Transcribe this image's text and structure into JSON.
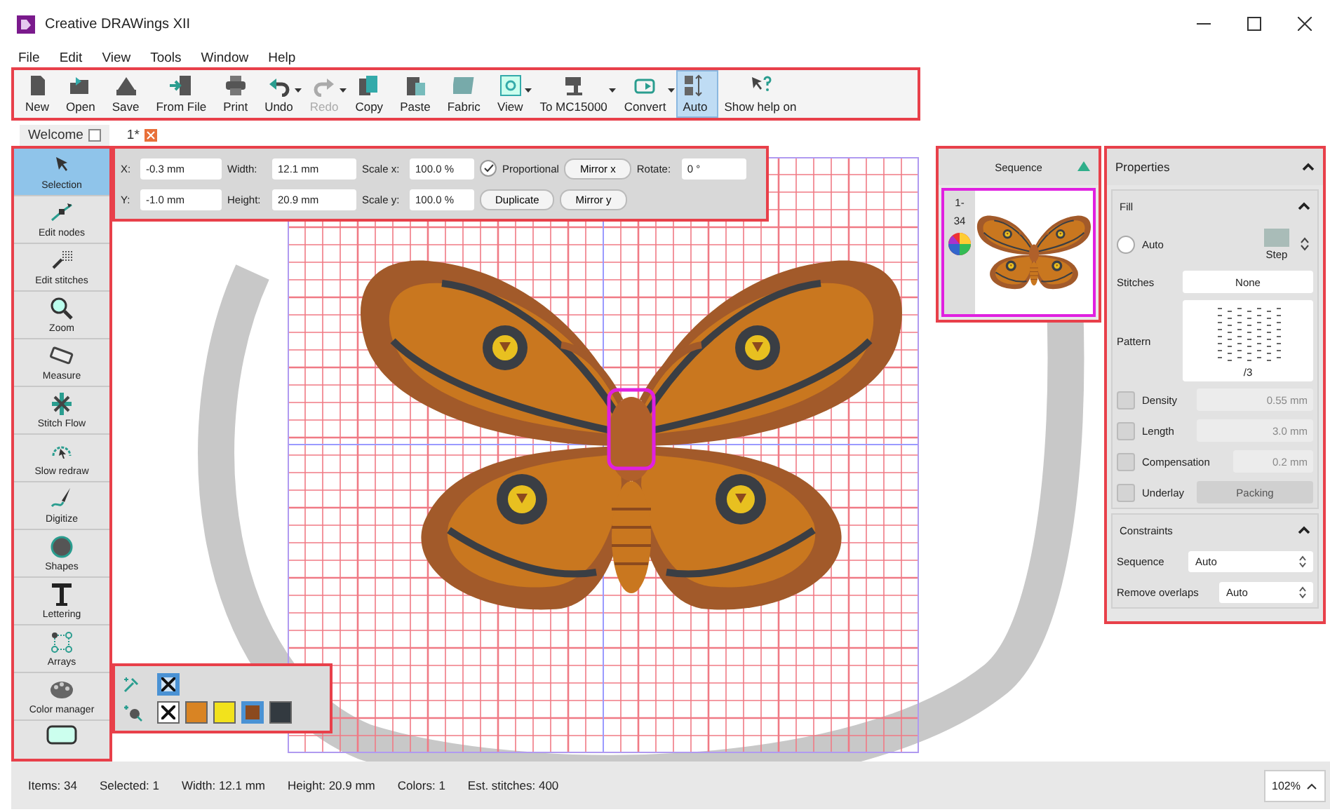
{
  "window": {
    "title": "Creative DRAWings XII"
  },
  "menu": [
    "File",
    "Edit",
    "View",
    "Tools",
    "Window",
    "Help"
  ],
  "toolbar": [
    {
      "label": "New",
      "dropdown": false,
      "disabled": false,
      "selected": false
    },
    {
      "label": "Open",
      "dropdown": false,
      "disabled": false,
      "selected": false
    },
    {
      "label": "Save",
      "dropdown": false,
      "disabled": false,
      "selected": false
    },
    {
      "label": "From File",
      "dropdown": false,
      "disabled": false,
      "selected": false
    },
    {
      "label": "Print",
      "dropdown": false,
      "disabled": false,
      "selected": false
    },
    {
      "label": "Undo",
      "dropdown": true,
      "disabled": false,
      "selected": false
    },
    {
      "label": "Redo",
      "dropdown": true,
      "disabled": true,
      "selected": false
    },
    {
      "label": "Copy",
      "dropdown": false,
      "disabled": false,
      "selected": false
    },
    {
      "label": "Paste",
      "dropdown": false,
      "disabled": false,
      "selected": false
    },
    {
      "label": "Fabric",
      "dropdown": false,
      "disabled": false,
      "selected": false
    },
    {
      "label": "View",
      "dropdown": true,
      "disabled": false,
      "selected": false
    },
    {
      "label": "To MC15000",
      "dropdown": true,
      "disabled": false,
      "selected": false
    },
    {
      "label": "Convert",
      "dropdown": true,
      "disabled": false,
      "selected": false
    },
    {
      "label": "Auto",
      "dropdown": false,
      "disabled": false,
      "selected": true
    },
    {
      "label": "Show help on",
      "dropdown": false,
      "disabled": false,
      "selected": false
    }
  ],
  "document_tabs": [
    {
      "label": "Welcome",
      "selected": false
    },
    {
      "label": "1*",
      "selected": true
    }
  ],
  "tools": [
    {
      "label": "Selection",
      "selected": true
    },
    {
      "label": "Edit nodes",
      "selected": false
    },
    {
      "label": "Edit stitches",
      "selected": false
    },
    {
      "label": "Zoom",
      "selected": false
    },
    {
      "label": "Measure",
      "selected": false
    },
    {
      "label": "Stitch Flow",
      "selected": false
    },
    {
      "label": "Slow redraw",
      "selected": false
    },
    {
      "label": "Digitize",
      "selected": false
    },
    {
      "label": "Shapes",
      "selected": false
    },
    {
      "label": "Lettering",
      "selected": false
    },
    {
      "label": "Arrays",
      "selected": false
    },
    {
      "label": "Color manager",
      "selected": false
    }
  ],
  "transform_bar": {
    "rows": [
      [
        {
          "kind": "field",
          "label": "X:",
          "value": "-0.3 mm"
        },
        {
          "kind": "field",
          "label": "Width:",
          "value": "12.1 mm"
        },
        {
          "kind": "field",
          "label": "Scale x:",
          "value": "100.0 %"
        },
        {
          "kind": "checkbox",
          "label": "Proportional",
          "checked": true
        },
        {
          "kind": "button",
          "label": "Mirror x"
        },
        {
          "kind": "field",
          "label": "Rotate:",
          "value": "0 °"
        }
      ],
      [
        {
          "kind": "field",
          "label": "Y:",
          "value": "-1.0 mm"
        },
        {
          "kind": "field",
          "label": "Height:",
          "value": "20.9 mm"
        },
        {
          "kind": "field",
          "label": "Scale y:",
          "value": "100.0 %"
        },
        {
          "kind": "button",
          "label": "Duplicate"
        },
        {
          "kind": "button",
          "label": "Mirror y"
        }
      ]
    ]
  },
  "sequence": {
    "title": "Sequence",
    "items": [
      {
        "range_start": "1-",
        "range_end": "34",
        "selected": true
      }
    ]
  },
  "color_bar": {
    "rows": [
      [
        {
          "kind": "none",
          "selected": true
        }
      ],
      [
        {
          "kind": "none",
          "selected": false
        },
        {
          "kind": "color",
          "color": "#d98423",
          "selected": false
        },
        {
          "kind": "color",
          "color": "#f2e21c",
          "selected": false
        },
        {
          "kind": "color",
          "color": "#8c4a1e",
          "selected": true
        },
        {
          "kind": "color",
          "color": "#333a40",
          "selected": false
        }
      ]
    ]
  },
  "properties": {
    "title": "Properties",
    "expanded": true,
    "fill": {
      "title": "Fill",
      "expanded": true,
      "auto": {
        "label": "Auto",
        "checked": false
      },
      "step_label": "Step",
      "rows": [
        {
          "kind": "select",
          "label": "Stitches",
          "value": "None"
        },
        {
          "kind": "pattern",
          "label": "Pattern",
          "caption": "/3"
        },
        {
          "kind": "check",
          "label": "Density",
          "checked": false,
          "value": "0.55 mm"
        },
        {
          "kind": "check",
          "label": "Length",
          "checked": false,
          "value": "3.0 mm"
        },
        {
          "kind": "check",
          "label": "Compensation",
          "checked": false,
          "value": "0.2 mm"
        },
        {
          "kind": "checkbutton",
          "label": "Underlay",
          "checked": false,
          "value": "Packing"
        }
      ]
    },
    "constraints": {
      "title": "Constraints",
      "expanded": true,
      "rows": [
        {
          "label": "Sequence",
          "value": "Auto"
        },
        {
          "label": "Remove overlaps",
          "value": "Auto"
        }
      ]
    }
  },
  "status_bar": {
    "items": [
      "Items: 34",
      "Selected: 1",
      "Width: 12.1 mm",
      "Height: 20.9 mm",
      "Colors: 1",
      "Est. stitches: 400"
    ],
    "zoom": "102%"
  }
}
